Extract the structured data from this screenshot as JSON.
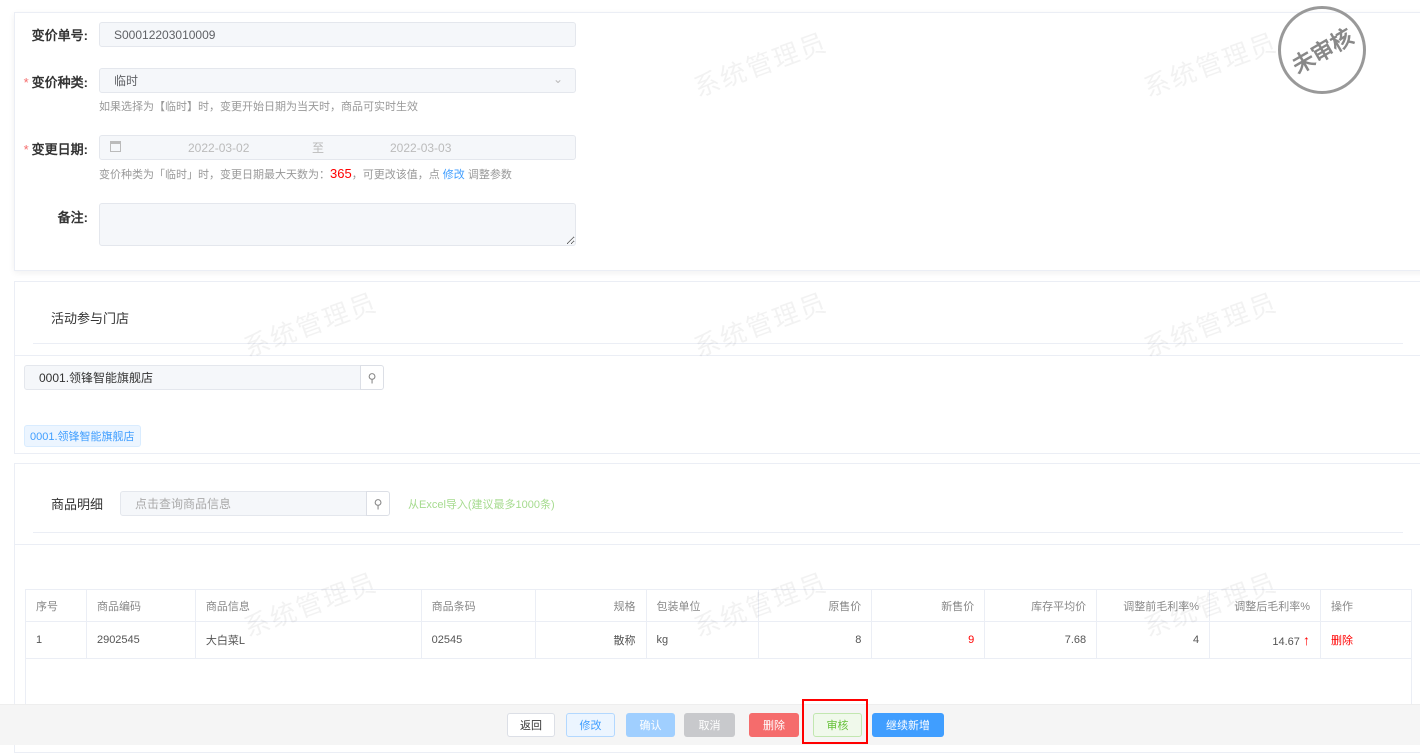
{
  "watermark": "系统管理员",
  "stamp": "未审核",
  "form": {
    "order_no_label": "变价单号:",
    "order_no": "S00012203010009",
    "type_label": "变价种类:",
    "type_value": "临时",
    "type_hint": "如果选择为【临时】时，变更开始日期为当天时，商品可实时生效",
    "date_label": "变更日期:",
    "date_start": "2022-03-02",
    "date_sep": "至",
    "date_end": "2022-03-03",
    "date_hint_a": "变价种类为「临时」时，变更日期最大天数为：",
    "date_hint_max": "365",
    "date_hint_b": "，可更改该值，点 ",
    "date_hint_link": "修改",
    "date_hint_c": " 调整参数",
    "remark_label": "备注:",
    "required_mark": "*"
  },
  "stores": {
    "title": "活动参与门店",
    "search_value": "0001.领锋智能旗舰店",
    "tag": "0001.领锋智能旗舰店"
  },
  "goods": {
    "title": "商品明细",
    "search_placeholder": "点击查询商品信息",
    "import_link": "从Excel导入(建议最多1000条)",
    "columns": [
      "序号",
      "商品编码",
      "商品信息",
      "商品条码",
      "规格",
      "包装单位",
      "原售价",
      "新售价",
      "库存平均价",
      "调整前毛利率%",
      "调整后毛利率%",
      "操作"
    ],
    "rows": [
      {
        "idx": "1",
        "code": "2902545",
        "info": "大白菜L",
        "barcode": "02545",
        "spec": "散称",
        "unit": "kg",
        "old_price": "8",
        "new_price": "9",
        "avg_cost": "7.68",
        "margin_before": "4",
        "margin_after": "14.67",
        "action": "删除"
      }
    ]
  },
  "footer": {
    "back": "返回",
    "edit": "修改",
    "confirm": "确认",
    "cancel": "取消",
    "delete": "删除",
    "audit": "审核",
    "continue_add": "继续新增"
  },
  "colors": {
    "primary": "#409eff",
    "danger": "#f56c6c",
    "success": "#67c23a"
  }
}
